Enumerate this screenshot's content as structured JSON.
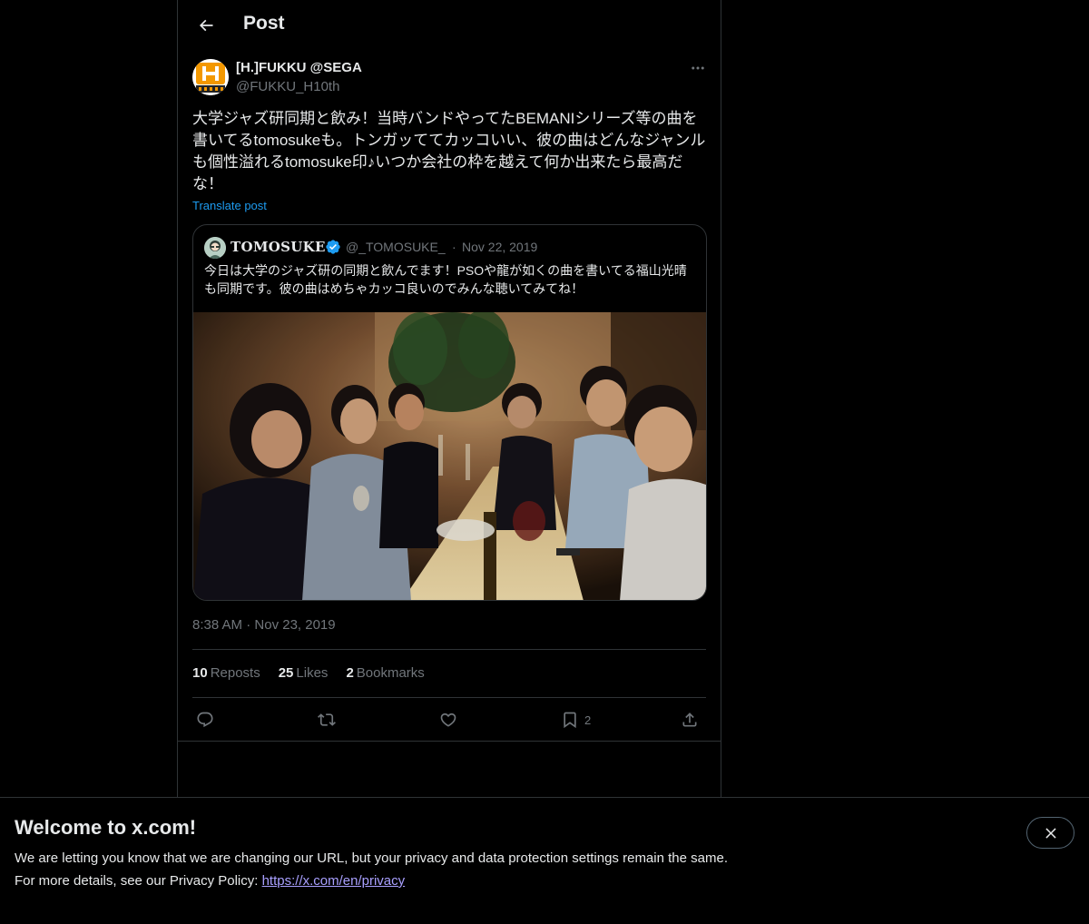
{
  "header": {
    "title": "Post",
    "back_icon": "arrow-left-icon"
  },
  "post": {
    "author": {
      "name": "[H.]FUKKU @SEGA",
      "handle": "@FUKKU_H10th",
      "avatar_text": "H"
    },
    "text": "大学ジャズ研同期と飲み！当時バンドやってたBEMANIシリーズ等の曲を書いてるtomosukeも。トンガッててカッコいい、彼の曲はどんなジャンルも個性溢れるtomosuke印♪いつか会社の枠を越えて何か出来たら最高だな！",
    "translate_label": "Translate post",
    "time": "8:38 AM",
    "separator": "·",
    "date": "Nov 23, 2019"
  },
  "quote": {
    "name": "TOMOSUKE",
    "verified": true,
    "handle": "@_TOMOSUKE_",
    "separator": "·",
    "date": "Nov 22, 2019",
    "text": "今日は大学のジャズ研の同期と飲んでます！PSOや龍が如くの曲を書いてる福山光晴も同期です。彼の曲はめちゃカッコ良いのでみんな聴いてみてね！"
  },
  "stats": {
    "reposts_count": "10",
    "reposts_label": "Reposts",
    "likes_count": "25",
    "likes_label": "Likes",
    "bookmarks_count": "2",
    "bookmarks_label": "Bookmarks"
  },
  "actions": {
    "reply_icon": "reply-icon",
    "repost_icon": "repost-icon",
    "like_icon": "heart-icon",
    "bookmark_icon": "bookmark-icon",
    "bookmark_count": "2",
    "share_icon": "share-icon"
  },
  "banner": {
    "title": "Welcome to x.com!",
    "line1": "We are letting you know that we are changing our URL, but your privacy and data protection settings remain the same.",
    "line2_prefix": "For more details, see our Privacy Policy: ",
    "link": "https://x.com/en/privacy",
    "close_icon": "close-icon"
  },
  "colors": {
    "background": "#000000",
    "text_primary": "#e7e9ea",
    "text_secondary": "#71767b",
    "accent": "#1d9bf0",
    "border": "#2f3336",
    "banner_link": "#a9a0ff"
  }
}
